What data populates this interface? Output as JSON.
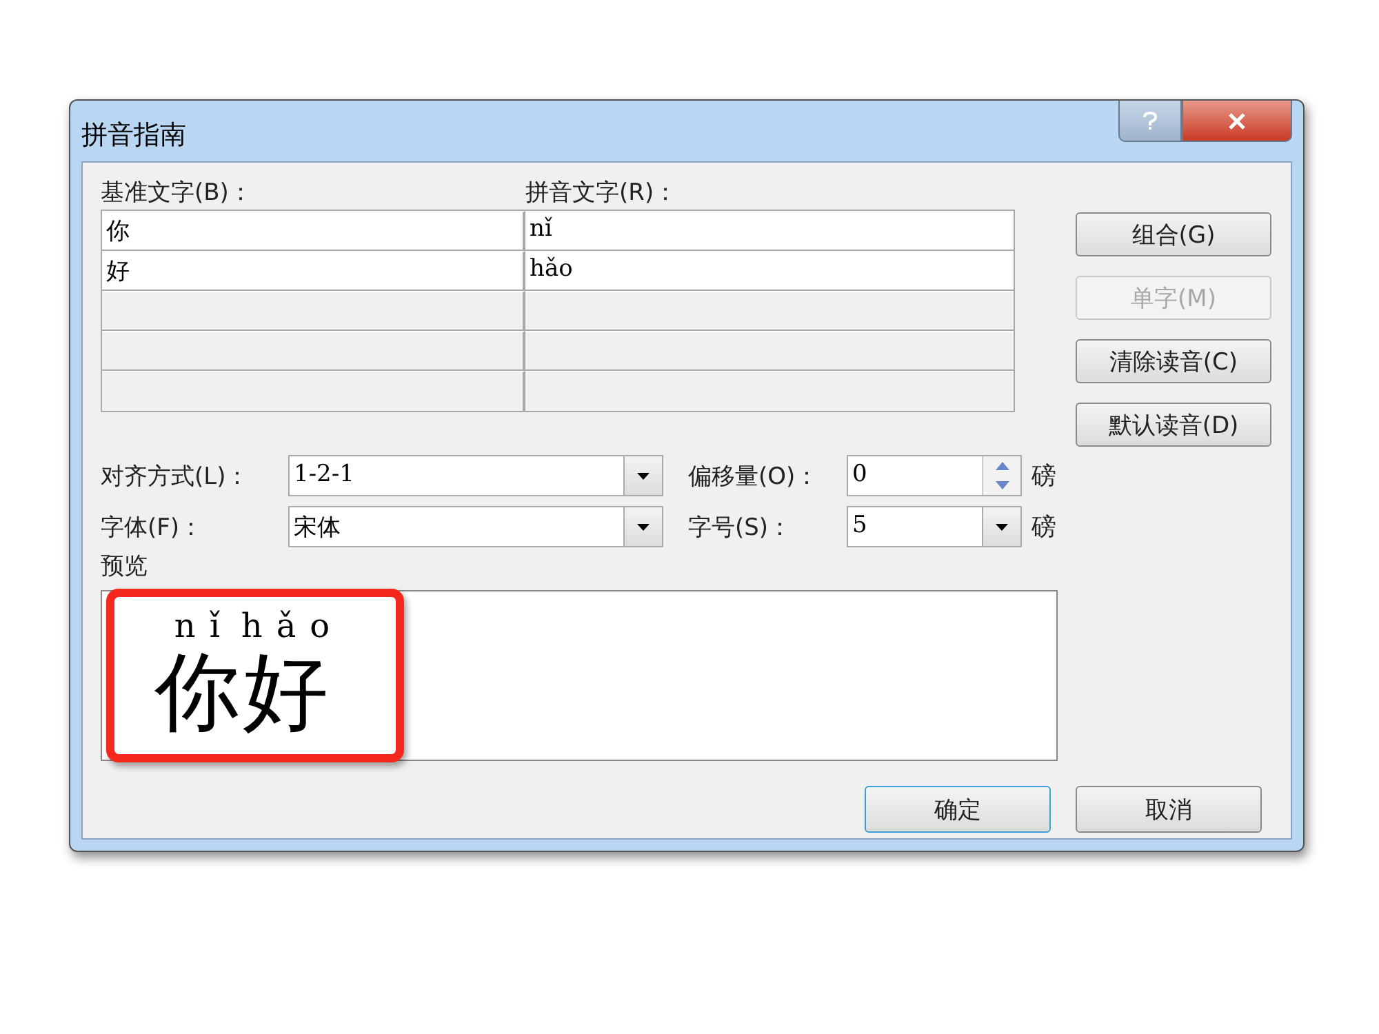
{
  "window": {
    "title": "拼音指南"
  },
  "grid": {
    "base_label": "基准文字(B)：",
    "ruby_label": "拼音文字(R)：",
    "rows": [
      {
        "filled": true,
        "base": "你",
        "ruby": "nǐ"
      },
      {
        "filled": true,
        "base": "好",
        "ruby": "hǎo"
      },
      {
        "filled": false
      },
      {
        "filled": false
      },
      {
        "filled": false
      }
    ]
  },
  "side_buttons": [
    {
      "label": "组合(G)",
      "disabled": false
    },
    {
      "label": "单字(M)",
      "disabled": true
    },
    {
      "label": "清除读音(C)",
      "disabled": false
    },
    {
      "label": "默认读音(D)",
      "disabled": false
    }
  ],
  "alignment": {
    "label": "对齐方式(L)：",
    "value": "1-2-1"
  },
  "offset": {
    "label": "偏移量(O)：",
    "value": "0",
    "unit": "磅"
  },
  "font": {
    "label": "字体(F)：",
    "value": "宋体"
  },
  "size": {
    "label": "字号(S)：",
    "value": "5",
    "unit": "磅"
  },
  "preview": {
    "label": "预览",
    "highlighted": true,
    "items": [
      {
        "base": "你",
        "ruby": "nǐ"
      },
      {
        "base": "好",
        "ruby": "hǎo"
      }
    ]
  },
  "footer_buttons": [
    {
      "label": "确定",
      "default": true
    },
    {
      "label": "取消",
      "default": false
    }
  ]
}
